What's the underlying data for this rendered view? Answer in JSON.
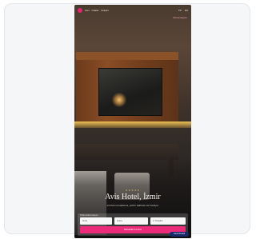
{
  "nav": {
    "items": [
      "Otel",
      "Odalar",
      "İletişim"
    ],
    "right": [
      "TR",
      "EN"
    ],
    "book_tag": "Rezervasyon"
  },
  "hero": {
    "stars": "★★★★★",
    "hotel_name": "Avis Hotel, İzmir",
    "tagline": "Konforlu konaklama, şehrin kalbinde sizi bekliyor"
  },
  "booking": {
    "label": "Online Rezervasyon",
    "checkin": "Giriş",
    "checkout": "Çıkış",
    "guests": "2 Yetişkin",
    "button": "Müsaitlik Kontrol"
  },
  "chat": {
    "label": "Canlı Destek"
  },
  "colors": {
    "accent": "#ec2c7a",
    "logo": "#e8226f",
    "chat": "#1a2a6c"
  }
}
